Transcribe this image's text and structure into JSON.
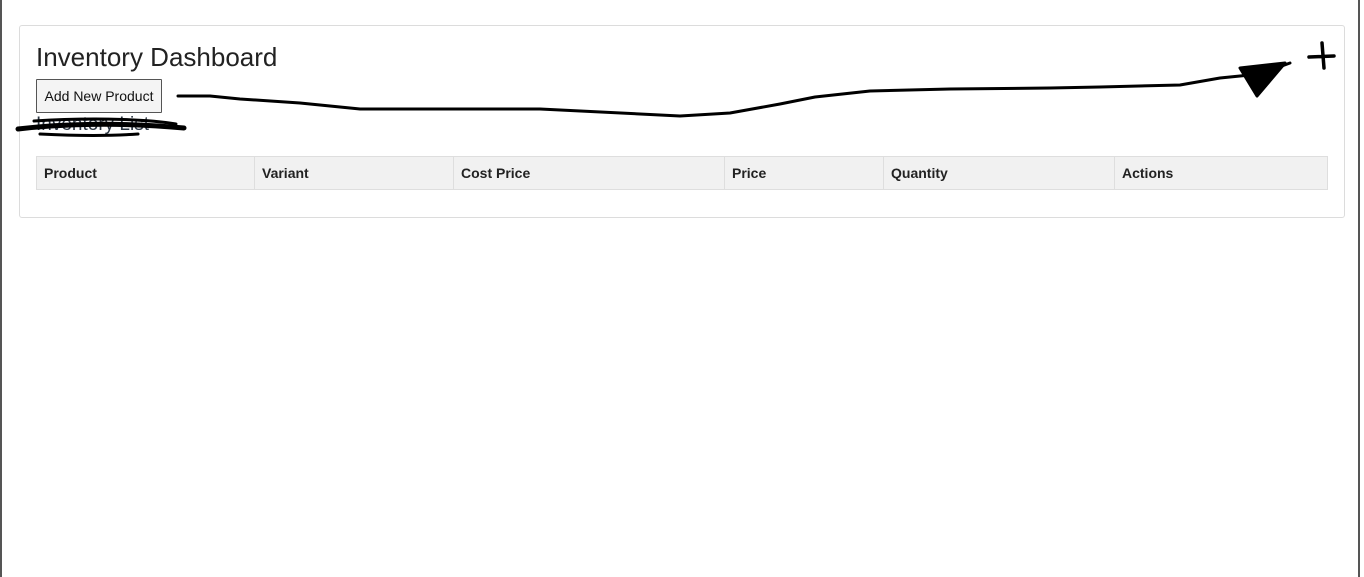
{
  "dashboard": {
    "title": "Inventory Dashboard",
    "add_button_label": "Add New Product",
    "list_title": "Inventory List"
  },
  "table": {
    "columns": [
      "Product",
      "Variant",
      "Cost Price",
      "Price",
      "Quantity",
      "Actions"
    ]
  },
  "annotations": {
    "plus_mark": "+"
  }
}
